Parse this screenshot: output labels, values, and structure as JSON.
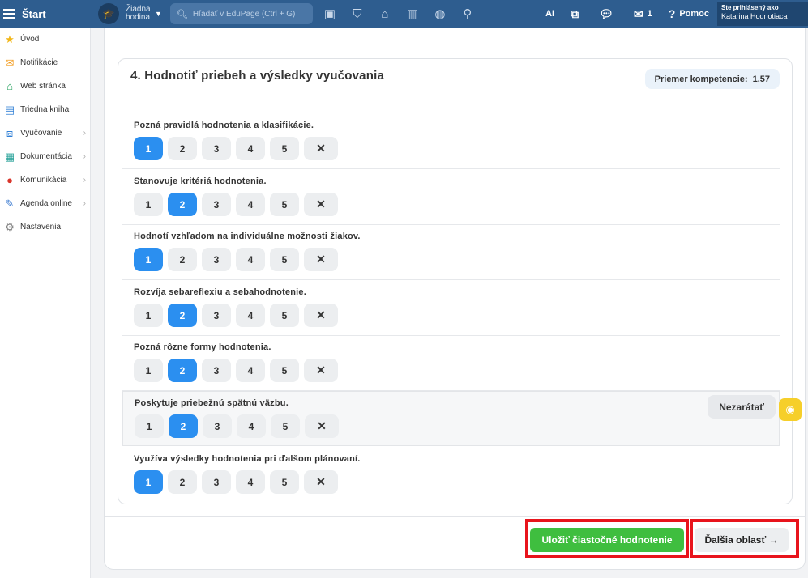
{
  "topbar": {
    "start_label": "Štart",
    "lesson_label": "Žiadna hodina",
    "search_placeholder": "Hľadať v EduPage (Ctrl + G)",
    "ai_label": "AI",
    "messages_count": "1",
    "help_label": "Pomoc",
    "user_caption": "Ste prihlásený ako",
    "user_name": "Katarina Hodnotiaca"
  },
  "sidebar": {
    "items": [
      {
        "label": "Úvod",
        "icon": "star-icon",
        "has_chevron": false
      },
      {
        "label": "Notifikácie",
        "icon": "envelope-icon",
        "has_chevron": false
      },
      {
        "label": "Web stránka",
        "icon": "home-icon",
        "has_chevron": false
      },
      {
        "label": "Triedna kniha",
        "icon": "book-icon",
        "has_chevron": false
      },
      {
        "label": "Vyučovanie",
        "icon": "open-book-icon",
        "has_chevron": true
      },
      {
        "label": "Dokumentácia",
        "icon": "document-icon",
        "has_chevron": true
      },
      {
        "label": "Komunikácia",
        "icon": "chat-icon",
        "has_chevron": true
      },
      {
        "label": "Agenda online",
        "icon": "pen-icon",
        "has_chevron": true
      },
      {
        "label": "Nastavenia",
        "icon": "gear-icon",
        "has_chevron": false
      }
    ]
  },
  "section": {
    "title": "4. Hodnotiť priebeh a výsledky vyučovania",
    "avg_label": "Priemer kompetencie:",
    "avg_value": "1.57"
  },
  "criteria": [
    {
      "label": "Pozná pravidlá hodnotenia a klasifikácie.",
      "selected": "1"
    },
    {
      "label": "Stanovuje kritériá hodnotenia.",
      "selected": "2"
    },
    {
      "label": "Hodnotí vzhľadom na individuálne možnosti žiakov.",
      "selected": "1"
    },
    {
      "label": "Rozvíja sebareflexiu a sebahodnotenie.",
      "selected": "2"
    },
    {
      "label": "Pozná rôzne formy hodnotenia.",
      "selected": "2"
    },
    {
      "label": "Poskytuje priebežnú spätnú väzbu.",
      "selected": "2"
    },
    {
      "label": "Využíva výsledky hodnotenia pri ďalšom plánovaní.",
      "selected": "1"
    }
  ],
  "options": [
    "1",
    "2",
    "3",
    "4",
    "5",
    "✕"
  ],
  "nezaratat_label": "Nezarátať",
  "footer": {
    "save_label": "Uložiť čiastočné hodnotenie",
    "next_label": "Ďalšia oblasť →"
  },
  "colors": {
    "topbar": "#2e5d8f",
    "selected": "#2b8ff0",
    "save": "#3fbe3f",
    "highlight": "#e8141c"
  }
}
